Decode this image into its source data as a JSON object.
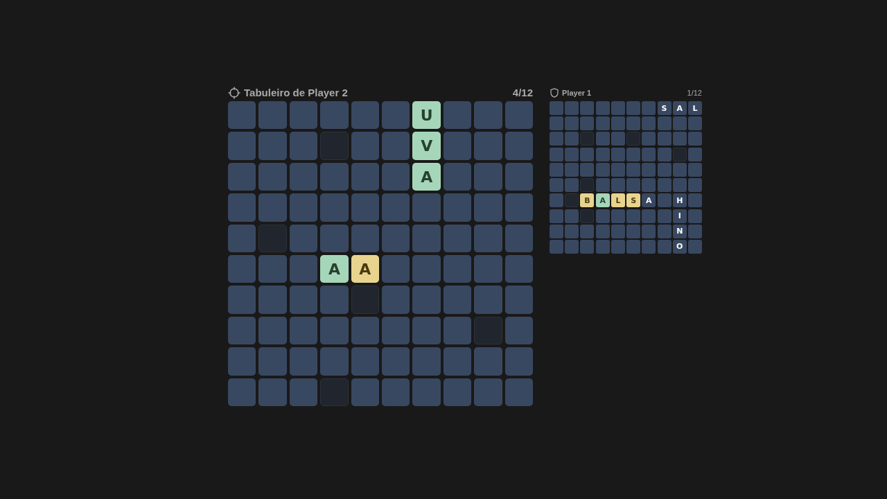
{
  "main_board": {
    "title": "Tabuleiro de Player 2",
    "count": "4/12",
    "rows": [
      [
        {
          "kind": "empty"
        },
        {
          "kind": "empty"
        },
        {
          "kind": "empty"
        },
        {
          "kind": "empty"
        },
        {
          "kind": "empty"
        },
        {
          "kind": "empty"
        },
        {
          "kind": "correct",
          "letter": "U"
        },
        {
          "kind": "empty"
        },
        {
          "kind": "empty"
        },
        {
          "kind": "empty"
        }
      ],
      [
        {
          "kind": "empty"
        },
        {
          "kind": "empty"
        },
        {
          "kind": "empty"
        },
        {
          "kind": "miss"
        },
        {
          "kind": "empty"
        },
        {
          "kind": "empty"
        },
        {
          "kind": "correct",
          "letter": "V"
        },
        {
          "kind": "empty"
        },
        {
          "kind": "empty"
        },
        {
          "kind": "empty"
        }
      ],
      [
        {
          "kind": "empty"
        },
        {
          "kind": "empty"
        },
        {
          "kind": "empty"
        },
        {
          "kind": "empty"
        },
        {
          "kind": "empty"
        },
        {
          "kind": "empty"
        },
        {
          "kind": "correct",
          "letter": "A"
        },
        {
          "kind": "empty"
        },
        {
          "kind": "empty"
        },
        {
          "kind": "empty"
        }
      ],
      [
        {
          "kind": "empty"
        },
        {
          "kind": "empty"
        },
        {
          "kind": "empty"
        },
        {
          "kind": "empty"
        },
        {
          "kind": "empty"
        },
        {
          "kind": "empty"
        },
        {
          "kind": "empty"
        },
        {
          "kind": "empty"
        },
        {
          "kind": "empty"
        },
        {
          "kind": "empty"
        }
      ],
      [
        {
          "kind": "empty"
        },
        {
          "kind": "miss"
        },
        {
          "kind": "empty"
        },
        {
          "kind": "empty"
        },
        {
          "kind": "empty"
        },
        {
          "kind": "empty"
        },
        {
          "kind": "empty"
        },
        {
          "kind": "empty"
        },
        {
          "kind": "empty"
        },
        {
          "kind": "empty"
        }
      ],
      [
        {
          "kind": "empty"
        },
        {
          "kind": "empty"
        },
        {
          "kind": "empty"
        },
        {
          "kind": "correct",
          "letter": "A"
        },
        {
          "kind": "present",
          "letter": "A"
        },
        {
          "kind": "empty"
        },
        {
          "kind": "empty"
        },
        {
          "kind": "empty"
        },
        {
          "kind": "empty"
        },
        {
          "kind": "empty"
        }
      ],
      [
        {
          "kind": "empty"
        },
        {
          "kind": "empty"
        },
        {
          "kind": "empty"
        },
        {
          "kind": "empty"
        },
        {
          "kind": "miss"
        },
        {
          "kind": "empty"
        },
        {
          "kind": "empty"
        },
        {
          "kind": "empty"
        },
        {
          "kind": "empty"
        },
        {
          "kind": "empty"
        }
      ],
      [
        {
          "kind": "empty"
        },
        {
          "kind": "empty"
        },
        {
          "kind": "empty"
        },
        {
          "kind": "empty"
        },
        {
          "kind": "empty"
        },
        {
          "kind": "empty"
        },
        {
          "kind": "empty"
        },
        {
          "kind": "empty"
        },
        {
          "kind": "miss"
        },
        {
          "kind": "empty"
        }
      ],
      [
        {
          "kind": "empty"
        },
        {
          "kind": "empty"
        },
        {
          "kind": "empty"
        },
        {
          "kind": "empty"
        },
        {
          "kind": "empty"
        },
        {
          "kind": "empty"
        },
        {
          "kind": "empty"
        },
        {
          "kind": "empty"
        },
        {
          "kind": "empty"
        },
        {
          "kind": "empty"
        }
      ],
      [
        {
          "kind": "empty"
        },
        {
          "kind": "empty"
        },
        {
          "kind": "empty"
        },
        {
          "kind": "miss"
        },
        {
          "kind": "empty"
        },
        {
          "kind": "empty"
        },
        {
          "kind": "empty"
        },
        {
          "kind": "empty"
        },
        {
          "kind": "empty"
        },
        {
          "kind": "empty"
        }
      ]
    ]
  },
  "side_board": {
    "title": "Player 1",
    "count": "1/12",
    "rows": [
      [
        {
          "kind": "empty"
        },
        {
          "kind": "empty"
        },
        {
          "kind": "empty"
        },
        {
          "kind": "empty"
        },
        {
          "kind": "empty"
        },
        {
          "kind": "empty"
        },
        {
          "kind": "empty"
        },
        {
          "kind": "revealed",
          "letter": "S"
        },
        {
          "kind": "revealed",
          "letter": "A"
        },
        {
          "kind": "revealed",
          "letter": "L"
        }
      ],
      [
        {
          "kind": "empty"
        },
        {
          "kind": "empty"
        },
        {
          "kind": "empty"
        },
        {
          "kind": "empty"
        },
        {
          "kind": "empty"
        },
        {
          "kind": "empty"
        },
        {
          "kind": "empty"
        },
        {
          "kind": "empty"
        },
        {
          "kind": "empty"
        },
        {
          "kind": "empty"
        }
      ],
      [
        {
          "kind": "empty"
        },
        {
          "kind": "empty"
        },
        {
          "kind": "miss"
        },
        {
          "kind": "empty"
        },
        {
          "kind": "empty"
        },
        {
          "kind": "miss"
        },
        {
          "kind": "empty"
        },
        {
          "kind": "empty"
        },
        {
          "kind": "empty"
        },
        {
          "kind": "empty"
        }
      ],
      [
        {
          "kind": "empty"
        },
        {
          "kind": "empty"
        },
        {
          "kind": "empty"
        },
        {
          "kind": "empty"
        },
        {
          "kind": "empty"
        },
        {
          "kind": "empty"
        },
        {
          "kind": "empty"
        },
        {
          "kind": "empty"
        },
        {
          "kind": "miss"
        },
        {
          "kind": "empty"
        }
      ],
      [
        {
          "kind": "empty"
        },
        {
          "kind": "empty"
        },
        {
          "kind": "empty"
        },
        {
          "kind": "empty"
        },
        {
          "kind": "empty"
        },
        {
          "kind": "empty"
        },
        {
          "kind": "empty"
        },
        {
          "kind": "empty"
        },
        {
          "kind": "empty"
        },
        {
          "kind": "empty"
        }
      ],
      [
        {
          "kind": "empty"
        },
        {
          "kind": "empty"
        },
        {
          "kind": "miss"
        },
        {
          "kind": "empty"
        },
        {
          "kind": "empty"
        },
        {
          "kind": "empty"
        },
        {
          "kind": "empty"
        },
        {
          "kind": "empty"
        },
        {
          "kind": "empty"
        },
        {
          "kind": "empty"
        }
      ],
      [
        {
          "kind": "empty"
        },
        {
          "kind": "miss"
        },
        {
          "kind": "present",
          "letter": "B"
        },
        {
          "kind": "correct",
          "letter": "A"
        },
        {
          "kind": "present",
          "letter": "L"
        },
        {
          "kind": "present",
          "letter": "S"
        },
        {
          "kind": "revealed",
          "letter": "A"
        },
        {
          "kind": "empty"
        },
        {
          "kind": "revealed",
          "letter": "H"
        },
        {
          "kind": "empty"
        }
      ],
      [
        {
          "kind": "empty"
        },
        {
          "kind": "empty"
        },
        {
          "kind": "miss"
        },
        {
          "kind": "empty"
        },
        {
          "kind": "empty"
        },
        {
          "kind": "empty"
        },
        {
          "kind": "empty"
        },
        {
          "kind": "empty"
        },
        {
          "kind": "revealed",
          "letter": "I"
        },
        {
          "kind": "empty"
        }
      ],
      [
        {
          "kind": "empty"
        },
        {
          "kind": "empty"
        },
        {
          "kind": "empty"
        },
        {
          "kind": "empty"
        },
        {
          "kind": "empty"
        },
        {
          "kind": "empty"
        },
        {
          "kind": "empty"
        },
        {
          "kind": "empty"
        },
        {
          "kind": "revealed",
          "letter": "N"
        },
        {
          "kind": "empty"
        }
      ],
      [
        {
          "kind": "empty"
        },
        {
          "kind": "empty"
        },
        {
          "kind": "empty"
        },
        {
          "kind": "empty"
        },
        {
          "kind": "empty"
        },
        {
          "kind": "empty"
        },
        {
          "kind": "empty"
        },
        {
          "kind": "empty"
        },
        {
          "kind": "revealed",
          "letter": "O"
        },
        {
          "kind": "empty"
        }
      ]
    ]
  }
}
